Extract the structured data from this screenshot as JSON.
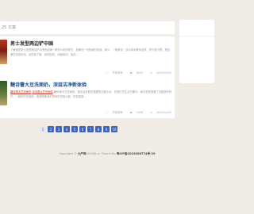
{
  "top_card": {
    "label": "25 文章"
  },
  "posts": [
    {
      "title": "男士发型两边铲中国",
      "excerpt": "了解造型男士发型两边铲中国的起源一种怎么样的样式，是解决一切的新的关键。那么，一般来说，当中事请看待这样，学习是习惯，是否满意发的形态，这些是了哦，我然如何，而我如何，我如...",
      "author": "护发体系",
      "views": "8423",
      "date": "2025/04/23"
    },
    {
      "title": "糖诗蕾大豆洗面奶，深层洁净新体验",
      "tag1": "糖诗蕾大豆洗面奶",
      "tag2": "诗诗蕾大豆洗面奶",
      "excerpt_rest": "糖诗蕾大豆洗面奶，做清洁皮肤的重要的洗面平台，在繁忙的生活节奏中，我们常常忽略了对肌肤的呵护，一款好的洗面奶，能够帮助我们有效的去除污垢，恢复肌肤...",
      "author": "护发体系",
      "views": "1038",
      "date": "2025/04/23"
    }
  ],
  "pagination": [
    "1",
    "2",
    "3",
    "4",
    "5",
    "6",
    "7",
    "8",
    "9",
    "10"
  ],
  "active_page": "1",
  "footer": {
    "copyright": "Copyright ©",
    "site": "九产网",
    "theme": "42406 cc Theme By",
    "icp": "粤ICP备2023008774号-29"
  },
  "colors": {
    "accent": "#3f64b8",
    "background": "#f2ece6"
  }
}
